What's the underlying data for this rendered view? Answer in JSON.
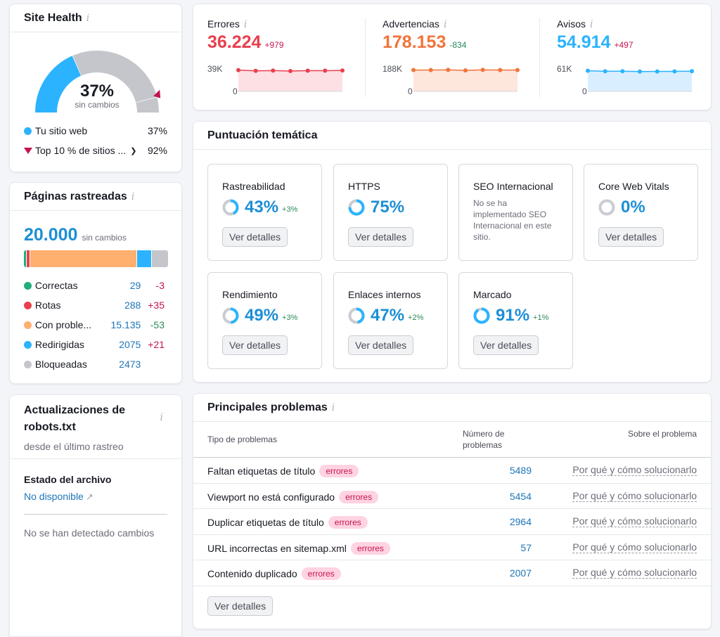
{
  "site_health": {
    "title": "Site Health",
    "info_icon": "info-icon",
    "score": "37%",
    "score_value": 37,
    "top10_value": 92,
    "change": "sin cambios",
    "legend": [
      {
        "label": "Tu sitio web",
        "value": "37%"
      },
      {
        "label": "Top 10 % de sitios ...",
        "value": "92%"
      }
    ],
    "colors": {
      "site": "#2bb3ff",
      "rest": "#c4c6cc",
      "top10": "#c4144f"
    }
  },
  "crawled": {
    "title": "Páginas rastreadas",
    "total": "20.000",
    "change": "sin cambios",
    "rows": [
      {
        "label": "Correctas",
        "count": "29",
        "delta": "-3",
        "delta_type": "red",
        "color": "#1fae7a",
        "share": 0.015
      },
      {
        "label": "Rotas",
        "count": "288",
        "delta": "+35",
        "delta_type": "red",
        "color": "#e8404f",
        "share": 0.02
      },
      {
        "label": "Con proble...",
        "count": "15.135",
        "delta": "-53",
        "delta_type": "green",
        "color": "#ffaf6e",
        "share": 0.745
      },
      {
        "label": "Redirigidas",
        "count": "2075",
        "delta": "+21",
        "delta_type": "red",
        "color": "#2bb3ff",
        "share": 0.095
      },
      {
        "label": "Bloqueadas",
        "count": "2473",
        "delta": "",
        "delta_type": "",
        "color": "#c4c6cc",
        "share": 0.115
      }
    ]
  },
  "robots": {
    "title": "Actualizaciones de robots.txt",
    "subtitle": "desde el último rastreo",
    "status_heading": "Estado del archivo",
    "status_link": "No disponible",
    "no_changes": "No se han detectado cambios"
  },
  "metrics": [
    {
      "label": "Errores",
      "value": "36.224",
      "delta": "+979",
      "delta_color": "#c4144f",
      "color": "#e8404f",
      "fill": "#fde0e3",
      "ymax_label": "39K",
      "ymin_label": "0",
      "ymax": 39000,
      "series": [
        36900,
        35700,
        36100,
        35400,
        35900,
        36000,
        36224
      ]
    },
    {
      "label": "Advertencias",
      "value": "178.153",
      "delta": "-834",
      "delta_color": "#2c8a5a",
      "color": "#f2743b",
      "fill": "#fde6dc",
      "ymax_label": "188K",
      "ymin_label": "0",
      "ymax": 188000,
      "series": [
        178500,
        178200,
        180200,
        175800,
        179800,
        178700,
        178153
      ]
    },
    {
      "label": "Avisos",
      "value": "54.914",
      "delta": "+497",
      "delta_color": "#c4144f",
      "color": "#2bb3ff",
      "fill": "#d9efff",
      "ymax_label": "61K",
      "ymin_label": "0",
      "ymax": 61000,
      "series": [
        55900,
        54500,
        54700,
        53900,
        54000,
        54300,
        54914
      ]
    }
  ],
  "thematic": {
    "title": "Puntuación temática",
    "button_label": "Ver detalles",
    "items": [
      {
        "name": "Rastreabilidad",
        "score": "43%",
        "value": 43,
        "delta": "+3%"
      },
      {
        "name": "HTTPS",
        "score": "75%",
        "value": 75,
        "delta": ""
      },
      {
        "name": "SEO Internacional",
        "description": "No se ha implementado SEO Internacional en este sitio."
      },
      {
        "name": "Core Web Vitals",
        "score": "0%",
        "value": 0,
        "delta": ""
      },
      {
        "name": "Rendimiento",
        "score": "49%",
        "value": 49,
        "delta": "+3%"
      },
      {
        "name": "Enlaces internos",
        "score": "47%",
        "value": 47,
        "delta": "+2%"
      },
      {
        "name": "Marcado",
        "score": "91%",
        "value": 91,
        "delta": "+1%"
      }
    ]
  },
  "issues": {
    "title": "Principales problemas",
    "columns": [
      "Tipo de problemas",
      "Número de problemas",
      "Sobre el problema"
    ],
    "badge": "errores",
    "link_label": "Por qué y cómo solucionarlo",
    "rows": [
      {
        "name": "Faltan etiquetas de título",
        "count": "5489"
      },
      {
        "name": "Viewport no está configurado",
        "count": "5454"
      },
      {
        "name": "Duplicar etiquetas de título",
        "count": "2964"
      },
      {
        "name": "URL incorrectas en sitemap.xml",
        "count": "57"
      },
      {
        "name": "Contenido duplicado",
        "count": "2007"
      }
    ],
    "button_label": "Ver detalles"
  }
}
